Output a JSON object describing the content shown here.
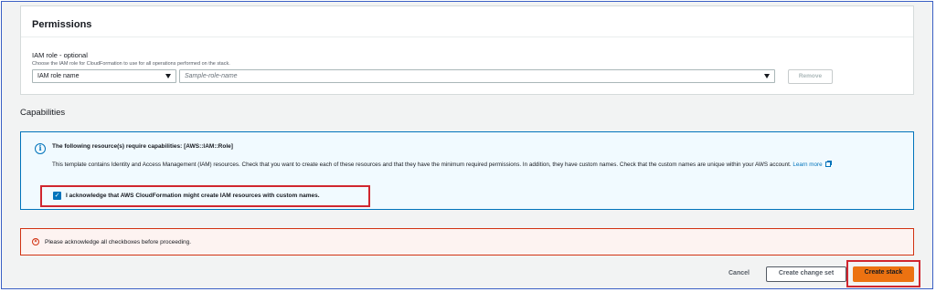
{
  "permissions": {
    "title": "Permissions",
    "iam_role_label": "IAM role - optional",
    "iam_role_description": "Choose the IAM role for CloudFormation to use for all operations performed on the stack.",
    "role_select_value": "IAM role name",
    "role_name_placeholder": "Sample-role-name",
    "remove_label": "Remove"
  },
  "capabilities": {
    "title": "Capabilities",
    "info_heading": "The following resource(s) require capabilities: [AWS::IAM::Role]",
    "info_body": "This template contains Identity and Access Management (IAM) resources. Check that you want to create each of these resources and that they have the minimum required permissions. In addition, they have custom names. Check that the custom names are unique within your AWS account.",
    "learn_more": "Learn more",
    "acknowledge_label": "I acknowledge that AWS CloudFormation might create IAM resources with custom names.",
    "acknowledge_checked": true
  },
  "error": {
    "message": "Please acknowledge all checkboxes before proceeding."
  },
  "footer": {
    "cancel_label": "Cancel",
    "change_set_label": "Create change set",
    "create_stack_label": "Create stack"
  },
  "colors": {
    "primary_button": "#ec7211",
    "info_border": "#0073bb",
    "error_border": "#d13212",
    "highlight_outline": "#d0262f"
  },
  "icons": {
    "info": "info-icon",
    "error": "error-circle-icon",
    "external_link": "external-link-icon",
    "dropdown": "caret-down-icon"
  }
}
